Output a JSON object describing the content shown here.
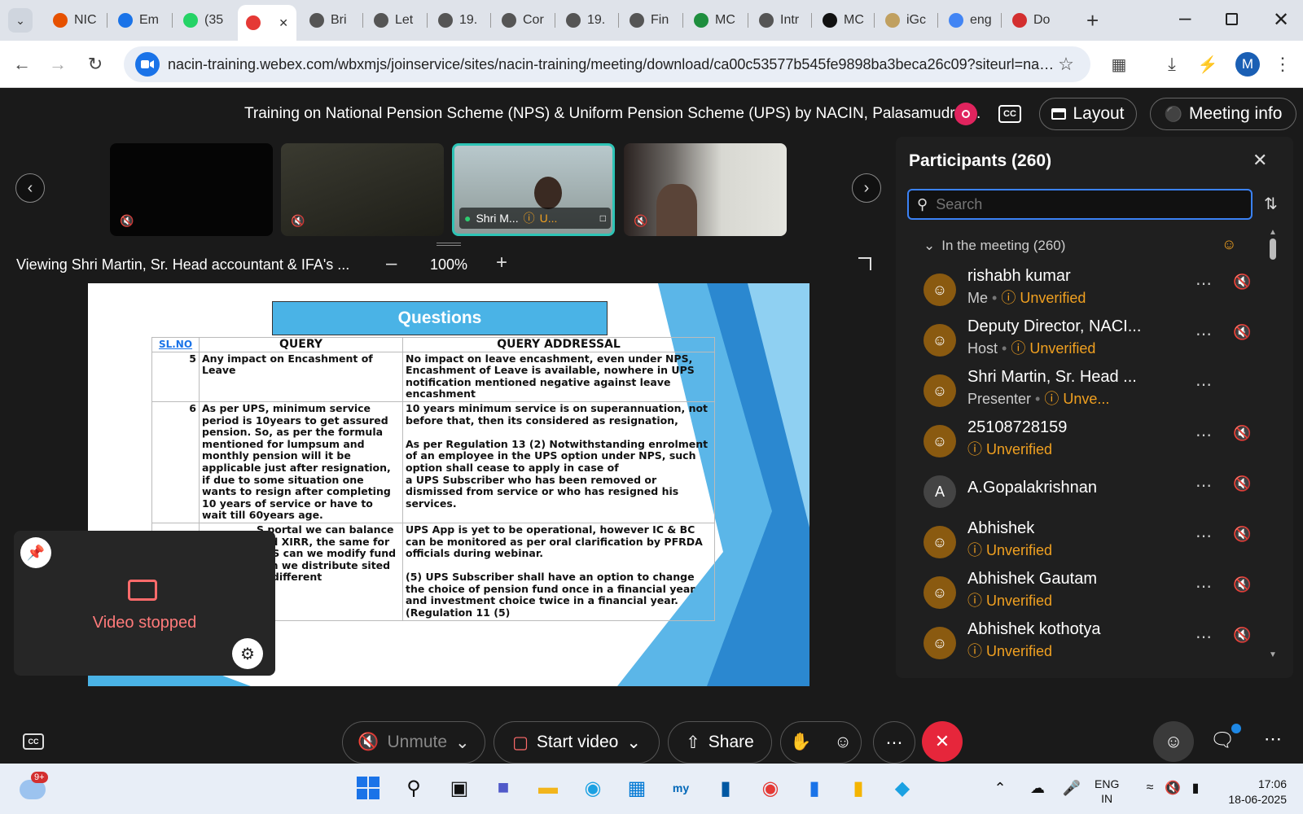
{
  "browser": {
    "tabs": [
      {
        "label": "NIC",
        "color": "#e65100"
      },
      {
        "label": "Em",
        "color": "#1a73e8"
      },
      {
        "label": "(35",
        "color": "#25d366"
      },
      {
        "label": "",
        "color": "#e53935"
      },
      {
        "label": "Bri",
        "color": "#555555"
      },
      {
        "label": "Let",
        "color": "#555555"
      },
      {
        "label": "19.",
        "color": "#555555"
      },
      {
        "label": "Cor",
        "color": "#555555"
      },
      {
        "label": "19.",
        "color": "#555555"
      },
      {
        "label": "Fin",
        "color": "#555555"
      },
      {
        "label": "MC",
        "color": "#1e8e3e"
      },
      {
        "label": "Intr",
        "color": "#555555"
      },
      {
        "label": "MC",
        "color": "#111111"
      },
      {
        "label": "iGc",
        "color": "#c0a060"
      },
      {
        "label": "eng",
        "color": "#4285f4"
      },
      {
        "label": "Do",
        "color": "#d32f2f"
      }
    ],
    "tab_35_badge": "35",
    "url": "nacin-training.webex.com/wbxmjs/joinservice/sites/nacin-training/meeting/download/ca00c53577b545fe9898ba3beca26c09?siteurl=nacin...",
    "profile_initial": "M"
  },
  "meeting": {
    "title": "Training on National Pension Scheme (NPS) & Uniform Pension Scheme (UPS) by NACIN, Palasamudram.",
    "layout_label": "Layout",
    "info_label": "Meeting info",
    "thumbnails": [
      {
        "label": ""
      },
      {
        "label": ""
      },
      {
        "label": "Shri M...",
        "status": "U..."
      },
      {
        "label": ""
      }
    ],
    "viewing": "Viewing Shri Martin, Sr. Head accountant & IFA's ...",
    "zoom": "100%",
    "self_view_status": "Video stopped"
  },
  "slide": {
    "title": "Questions",
    "headers": [
      "SL.NO",
      "QUERY",
      "QUERY ADDRESSAL"
    ],
    "rows": [
      {
        "no": "5",
        "query": "Any impact on Encashment of Leave",
        "answer": "No impact on leave encashment, even under NPS, Encashment of Leave is available, nowhere in UPS notification mentioned negative against leave encashment"
      },
      {
        "no": "6",
        "query": "As per UPS, minimum service period is 10years to get assured pension. So, as per the formula mentioned for lumpsum and monthly pension will it be applicable just after resignation, if due to some situation one wants to resign after completing 10 years of service or have to wait till 60years age.",
        "answer": "10 years minimum service is on superannuation, not before that, then its considered as resignation,\n\n As per Regulation 13 (2) Notwithstanding enrolment of an employee in the UPS option under NPS, such option shall cease to apply in case of\na UPS Subscriber who has been removed or dismissed from service or who has resigned his services."
      },
      {
        "no": "",
        "query": "S portal we can balance and XIRR, the same for UPS can we modify fund Can we distribute sited to different",
        "answer": "UPS App is yet to be operational, however IC & BC can be monitored as per oral clarification by PFRDA officials during webinar.\n\n(5) UPS Subscriber shall have an option to change the choice of pension fund once in a financial year and investment choice twice in a financial year. (Regulation 11 (5)"
      }
    ]
  },
  "participants": {
    "title": "Participants (260)",
    "search_placeholder": "Search",
    "section": "In the meeting (260)",
    "list": [
      {
        "name": "rishabh kumar",
        "role": "Me",
        "status": "Unverified",
        "initial": ""
      },
      {
        "name": "Deputy Director, NACI...",
        "role": "Host",
        "status": "Unverified",
        "initial": ""
      },
      {
        "name": "Shri Martin, Sr. Head ...",
        "role": "Presenter",
        "status": "Unve...",
        "initial": ""
      },
      {
        "name": "25108728159",
        "role": "",
        "status": "Unverified",
        "initial": ""
      },
      {
        "name": "A.Gopalakrishnan",
        "role": "",
        "status": "",
        "initial": "A"
      },
      {
        "name": "Abhishek",
        "role": "",
        "status": "Unverified",
        "initial": ""
      },
      {
        "name": "Abhishek Gautam",
        "role": "",
        "status": "Unverified",
        "initial": ""
      },
      {
        "name": "Abhishek kothotya",
        "role": "",
        "status": "Unverified",
        "initial": ""
      }
    ]
  },
  "controls": {
    "unmute": "Unmute",
    "start_video": "Start video",
    "share": "Share"
  },
  "taskbar": {
    "weather_badge": "9+",
    "lang_top": "ENG",
    "lang_bottom": "IN",
    "time": "17:06",
    "date": "18-06-2025"
  }
}
